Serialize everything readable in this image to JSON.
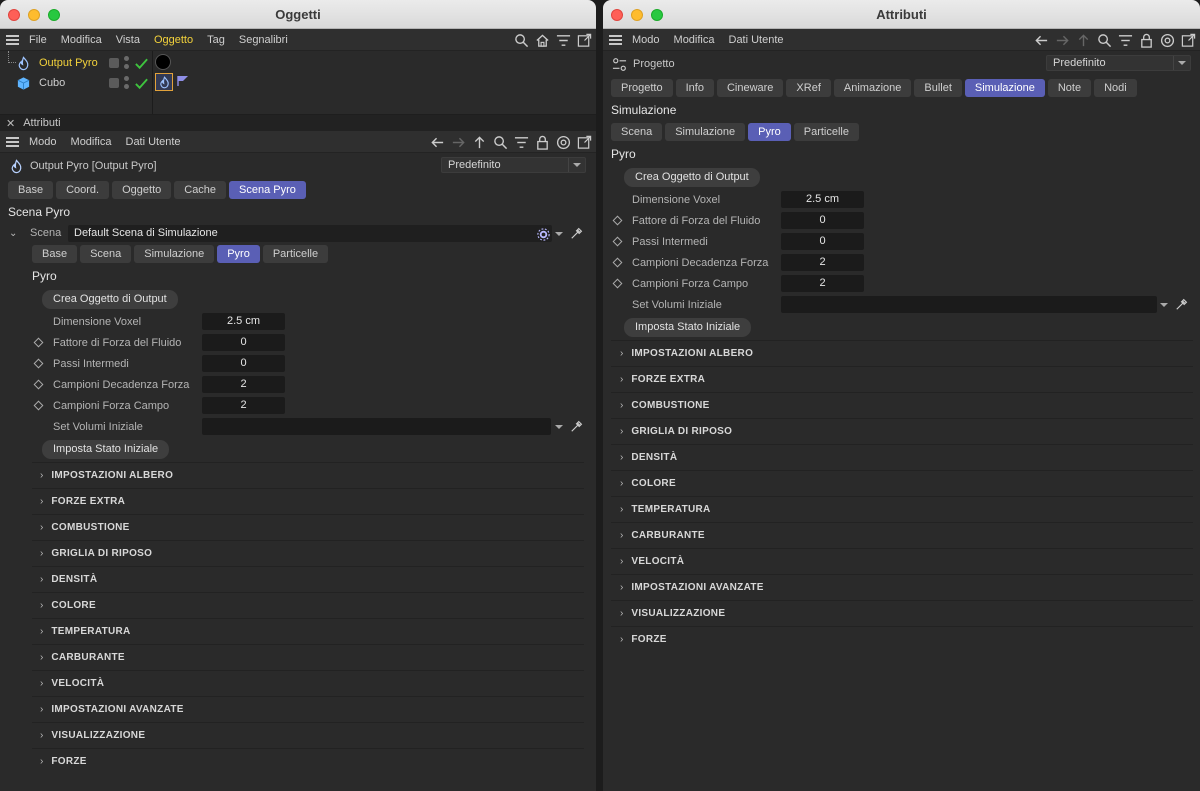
{
  "left_window": {
    "title": "Oggetti",
    "menu": [
      "File",
      "Modifica",
      "Vista",
      "Oggetto",
      "Tag",
      "Segnalibri"
    ],
    "active_menu": "Oggetto",
    "objects": [
      {
        "name": "Output Pyro",
        "selected": true
      },
      {
        "name": "Cubo",
        "selected": false
      }
    ],
    "attr_panel": {
      "header": "Attributi",
      "menu": [
        "Modo",
        "Modifica",
        "Dati Utente"
      ],
      "object_label": "Output Pyro [Output Pyro]",
      "preset": "Predefinito",
      "tabs": [
        "Base",
        "Coord.",
        "Oggetto",
        "Cache",
        "Scena Pyro"
      ],
      "active_tab": "Scena Pyro",
      "section_title": "Scena Pyro",
      "scene_label": "Scena",
      "scene_value": "Default Scena di Simulazione",
      "subtabs": [
        "Base",
        "Scena",
        "Simulazione",
        "Pyro",
        "Particelle"
      ],
      "active_subtab": "Pyro",
      "pyro_title": "Pyro",
      "create_button": "Crea Oggetto di Output",
      "params": [
        {
          "label": "Dimensione Voxel",
          "value": "2.5 cm",
          "anim": false
        },
        {
          "label": "Fattore di Forza del Fluido",
          "value": "0",
          "anim": true
        },
        {
          "label": "Passi Intermedi",
          "value": "0",
          "anim": true
        },
        {
          "label": "Campioni Decadenza Forza",
          "value": "2",
          "anim": true
        },
        {
          "label": "Campioni Forza Campo",
          "value": "2",
          "anim": true
        }
      ],
      "volume_label": "Set Volumi Iniziale",
      "set_state_button": "Imposta Stato Iniziale",
      "groups": [
        "IMPOSTAZIONI ALBERO",
        "FORZE EXTRA",
        "COMBUSTIONE",
        "GRIGLIA DI RIPOSO",
        "DENSITÀ",
        "COLORE",
        "TEMPERATURA",
        "CARBURANTE",
        "VELOCITÀ",
        "IMPOSTAZIONI AVANZATE",
        "VISUALIZZAZIONE",
        "FORZE"
      ]
    }
  },
  "right_window": {
    "title": "Attributi",
    "menu": [
      "Modo",
      "Modifica",
      "Dati Utente"
    ],
    "object_label": "Progetto",
    "preset": "Predefinito",
    "tabs": [
      "Progetto",
      "Info",
      "Cineware",
      "XRef",
      "Animazione",
      "Bullet",
      "Simulazione",
      "Note",
      "Nodi"
    ],
    "active_tab": "Simulazione",
    "section_title": "Simulazione",
    "subtabs": [
      "Scena",
      "Simulazione",
      "Pyro",
      "Particelle"
    ],
    "active_subtab": "Pyro",
    "pyro_title": "Pyro",
    "create_button": "Crea Oggetto di Output",
    "params": [
      {
        "label": "Dimensione Voxel",
        "value": "2.5 cm",
        "anim": false
      },
      {
        "label": "Fattore di Forza del Fluido",
        "value": "0",
        "anim": true
      },
      {
        "label": "Passi Intermedi",
        "value": "0",
        "anim": true
      },
      {
        "label": "Campioni Decadenza Forza",
        "value": "2",
        "anim": true
      },
      {
        "label": "Campioni Forza Campo",
        "value": "2",
        "anim": true
      }
    ],
    "volume_label": "Set Volumi Iniziale",
    "set_state_button": "Imposta Stato Iniziale",
    "groups": [
      "IMPOSTAZIONI ALBERO",
      "FORZE EXTRA",
      "COMBUSTIONE",
      "GRIGLIA DI RIPOSO",
      "DENSITÀ",
      "COLORE",
      "TEMPERATURA",
      "CARBURANTE",
      "VELOCITÀ",
      "IMPOSTAZIONI AVANZATE",
      "VISUALIZZAZIONE",
      "FORZE"
    ]
  },
  "colors": {
    "accent": "#5a5fb5",
    "selected_text": "#f3d23b",
    "check": "#3ec43e"
  }
}
